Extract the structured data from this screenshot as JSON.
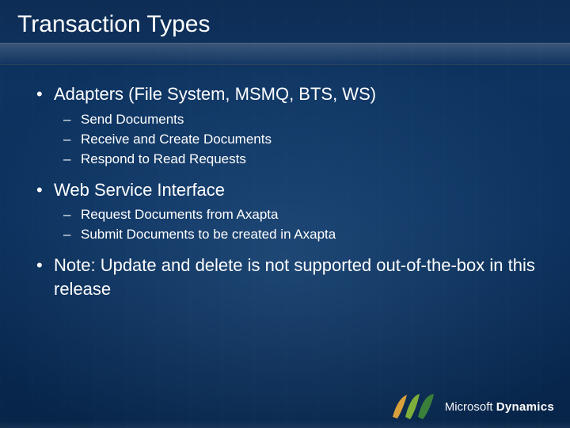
{
  "title": "Transaction Types",
  "bullets": {
    "adapters": {
      "label": "Adapters (File System, MSMQ, BTS, WS)",
      "items": [
        "Send Documents",
        "Receive and Create Documents",
        "Respond to Read Requests"
      ]
    },
    "webservice": {
      "label": "Web Service Interface",
      "items": [
        "Request Documents from Axapta",
        "Submit Documents to be created in Axapta"
      ]
    },
    "note": {
      "label": "Note: Update and delete is not supported out-of-the-box in this release"
    }
  },
  "brand": {
    "name_light": "Microsoft",
    "name_bold": "Dynamics",
    "logo_colors": {
      "left": "#d9a13b",
      "mid": "#7fae3a",
      "right": "#3a7f3a"
    }
  }
}
